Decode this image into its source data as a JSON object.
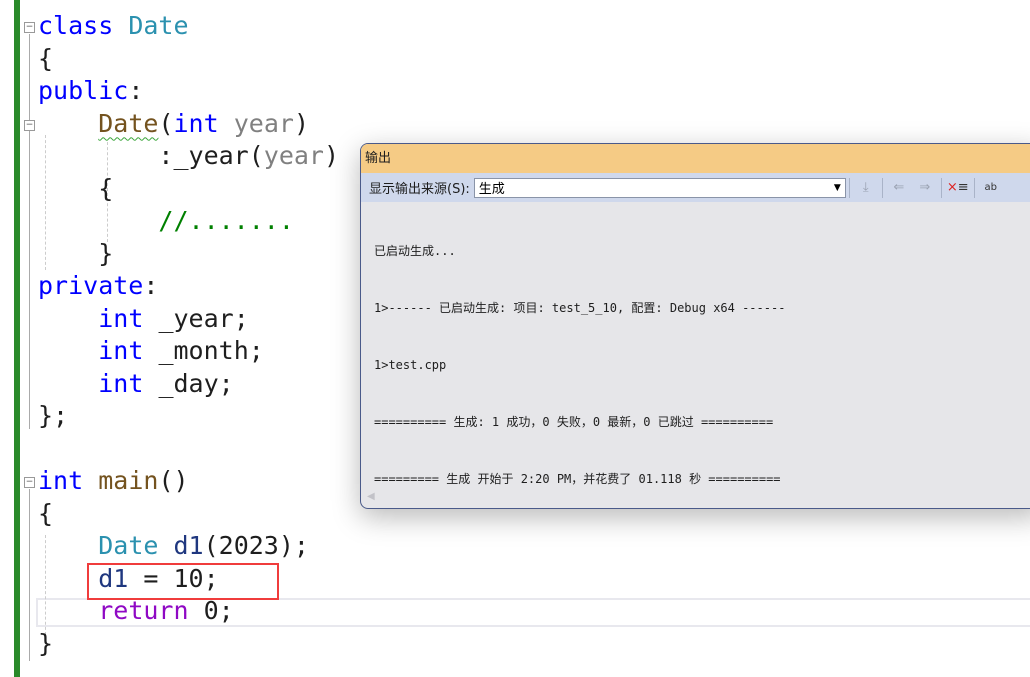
{
  "editor": {
    "lines": [
      [
        [
          "class ",
          "kw"
        ],
        [
          "Date",
          "type"
        ]
      ],
      [
        [
          "{",
          ""
        ]
      ],
      [
        [
          "public",
          "kw"
        ],
        [
          ":",
          ""
        ]
      ],
      [
        [
          "    ",
          ""
        ],
        [
          "Date",
          "fn squig"
        ],
        [
          "(",
          ""
        ],
        [
          "int ",
          "kw"
        ],
        [
          "year",
          "param"
        ],
        [
          ")",
          ""
        ]
      ],
      [
        [
          "        :_year(",
          ""
        ],
        [
          "year",
          "param"
        ],
        [
          ")",
          ""
        ]
      ],
      [
        [
          "    {",
          ""
        ]
      ],
      [
        [
          "        ",
          ""
        ],
        [
          "//.......",
          "cm"
        ]
      ],
      [
        [
          "    }",
          ""
        ]
      ],
      [
        [
          "private",
          "kw"
        ],
        [
          ":",
          ""
        ]
      ],
      [
        [
          "    ",
          ""
        ],
        [
          "int ",
          "kw"
        ],
        [
          "_year;",
          ""
        ]
      ],
      [
        [
          "    ",
          ""
        ],
        [
          "int ",
          "kw"
        ],
        [
          "_month;",
          ""
        ]
      ],
      [
        [
          "    ",
          ""
        ],
        [
          "int ",
          "kw"
        ],
        [
          "_day;",
          ""
        ]
      ],
      [
        [
          "};",
          ""
        ]
      ],
      [
        [
          "",
          ""
        ]
      ],
      [
        [
          "int ",
          "kw"
        ],
        [
          "main",
          "fn"
        ],
        [
          "()",
          ""
        ]
      ],
      [
        [
          "{",
          ""
        ]
      ],
      [
        [
          "    ",
          ""
        ],
        [
          "Date ",
          "type"
        ],
        [
          "d1",
          "var"
        ],
        [
          "(2023);",
          ""
        ]
      ],
      [
        [
          "    ",
          ""
        ],
        [
          "d1",
          "var"
        ],
        [
          " = 10;",
          ""
        ]
      ],
      [
        [
          "    ",
          ""
        ],
        [
          "return ",
          "ctl"
        ],
        [
          "0;",
          ""
        ]
      ],
      [
        [
          "}",
          ""
        ]
      ]
    ],
    "colors": {
      "keyword": "#0000ff",
      "type": "#2b91af",
      "function": "#74531f",
      "comment": "#008000",
      "control": "#8f08c4",
      "highlight_box": "#f03c3c"
    }
  },
  "output": {
    "title": "输出",
    "source_label": "显示输出来源(S):",
    "source_value": "生成",
    "toolbar_icons": [
      "find-message-icon",
      "prev-message-icon",
      "next-message-icon",
      "clear-all-icon",
      "word-wrap-icon"
    ],
    "lines": [
      "已启动生成...",
      "1>------ 已启动生成: 项目: test_5_10, 配置: Debug x64 ------",
      "1>test.cpp",
      "========== 生成: 1 成功，0 失败，0 最新，0 已跳过 ==========",
      "========= 生成 开始于 2:20 PM，并花费了 01.118 秒 =========="
    ]
  }
}
